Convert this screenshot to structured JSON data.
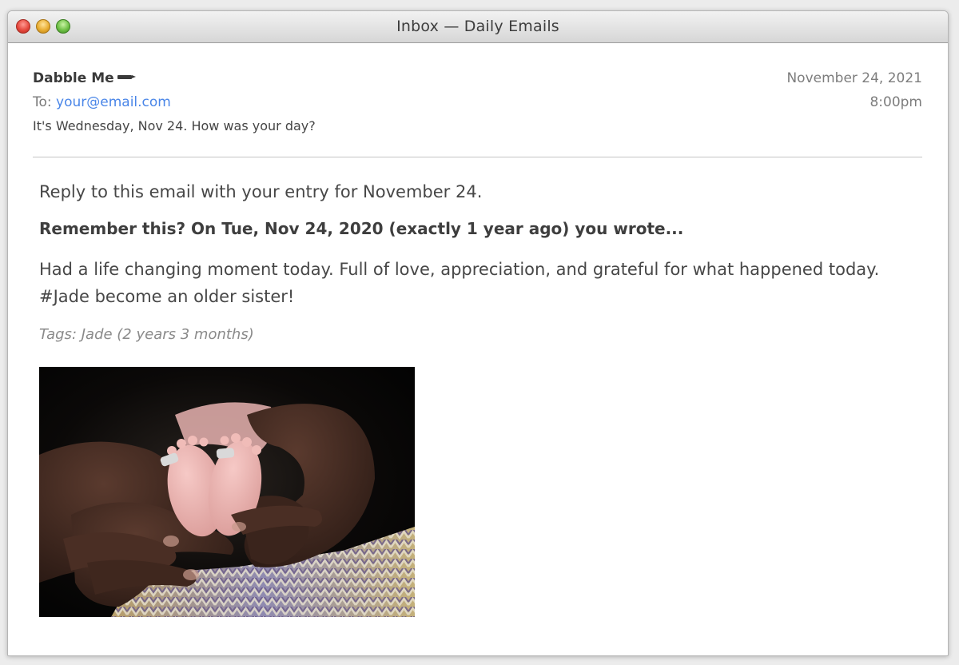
{
  "window": {
    "title": "Inbox — Daily Emails",
    "controls": [
      "close",
      "minimize",
      "maximize"
    ]
  },
  "email": {
    "from": "Dabble Me",
    "from_icon": "pen-icon",
    "to_label": "To:",
    "to_address": "your@email.com",
    "subject": "It's Wednesday, Nov 24. How was your day?",
    "date": "November 24, 2021",
    "time": "8:00pm"
  },
  "body": {
    "reply_prompt": "Reply to this email with your entry for November 24.",
    "remember_heading": "Remember this? On Tue, Nov 24, 2020 (exactly 1 year ago) you wrote...",
    "entry_text": "Had a life changing moment today. Full of love, appreciation, and grateful for what happened today. #Jade become an older sister!",
    "tags": "Tags: Jade (2 years 3 months)",
    "photo": "hands-holding-baby-feet-photo"
  },
  "colors": {
    "link": "#4a86e8",
    "text": "#474747",
    "muted": "#7d7d7d",
    "divider": "#c4c4c4"
  }
}
